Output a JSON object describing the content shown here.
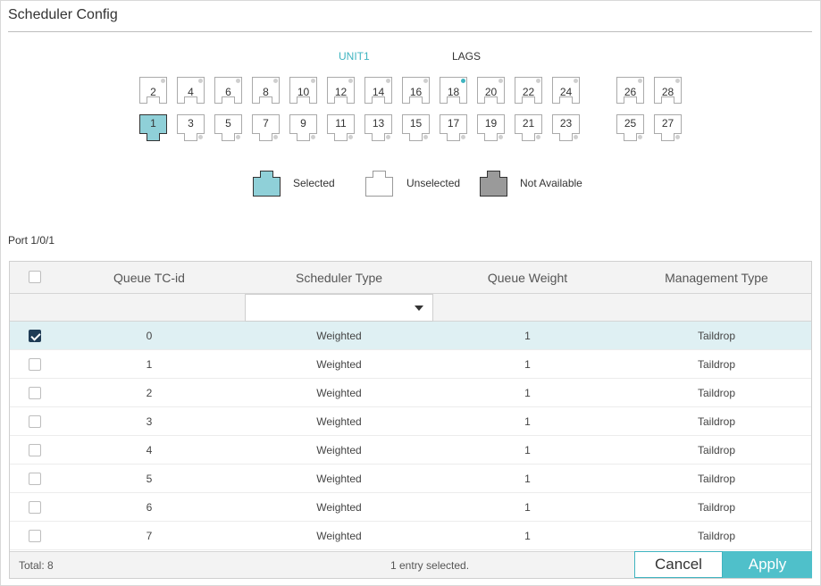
{
  "page": {
    "title": "Scheduler Config"
  },
  "unit_tabs": [
    {
      "label": "UNIT1",
      "active": true
    },
    {
      "label": "LAGS",
      "active": false
    }
  ],
  "ports": {
    "top_row": [
      {
        "num": "2",
        "link": false
      },
      {
        "num": "4",
        "link": false
      },
      {
        "num": "6",
        "link": false
      },
      {
        "num": "8",
        "link": false
      },
      {
        "num": "10",
        "link": false
      },
      {
        "num": "12",
        "link": false
      },
      {
        "num": "14",
        "link": false
      },
      {
        "num": "16",
        "link": false
      },
      {
        "num": "18",
        "link": true
      },
      {
        "num": "20",
        "link": false
      },
      {
        "num": "22",
        "link": false
      },
      {
        "num": "24",
        "link": false
      },
      {
        "num": "26",
        "link": false
      },
      {
        "num": "28",
        "link": false
      }
    ],
    "bottom_row": [
      {
        "num": "1",
        "selected": true
      },
      {
        "num": "3"
      },
      {
        "num": "5"
      },
      {
        "num": "7"
      },
      {
        "num": "9"
      },
      {
        "num": "11"
      },
      {
        "num": "13"
      },
      {
        "num": "15"
      },
      {
        "num": "17"
      },
      {
        "num": "19"
      },
      {
        "num": "21"
      },
      {
        "num": "23"
      },
      {
        "num": "25"
      },
      {
        "num": "27"
      }
    ]
  },
  "legend": {
    "selected": "Selected",
    "unselected": "Unselected",
    "not_available": "Not Available"
  },
  "port_label": "Port 1/0/1",
  "table": {
    "columns": [
      "Queue TC-id",
      "Scheduler Type",
      "Queue Weight",
      "Management Type"
    ],
    "filter_value": "",
    "rows": [
      {
        "tc": "0",
        "type": "Weighted",
        "weight": "1",
        "mgmt": "Taildrop",
        "checked": true
      },
      {
        "tc": "1",
        "type": "Weighted",
        "weight": "1",
        "mgmt": "Taildrop",
        "checked": false
      },
      {
        "tc": "2",
        "type": "Weighted",
        "weight": "1",
        "mgmt": "Taildrop",
        "checked": false
      },
      {
        "tc": "3",
        "type": "Weighted",
        "weight": "1",
        "mgmt": "Taildrop",
        "checked": false
      },
      {
        "tc": "4",
        "type": "Weighted",
        "weight": "1",
        "mgmt": "Taildrop",
        "checked": false
      },
      {
        "tc": "5",
        "type": "Weighted",
        "weight": "1",
        "mgmt": "Taildrop",
        "checked": false
      },
      {
        "tc": "6",
        "type": "Weighted",
        "weight": "1",
        "mgmt": "Taildrop",
        "checked": false
      },
      {
        "tc": "7",
        "type": "Weighted",
        "weight": "1",
        "mgmt": "Taildrop",
        "checked": false
      }
    ],
    "total": "Total: 8",
    "selection_status": "1 entry selected."
  },
  "buttons": {
    "cancel": "Cancel",
    "apply": "Apply"
  },
  "colors": {
    "accent": "#3fb4c0",
    "selected_port": "#8fd0d8",
    "not_available": "#999999"
  }
}
